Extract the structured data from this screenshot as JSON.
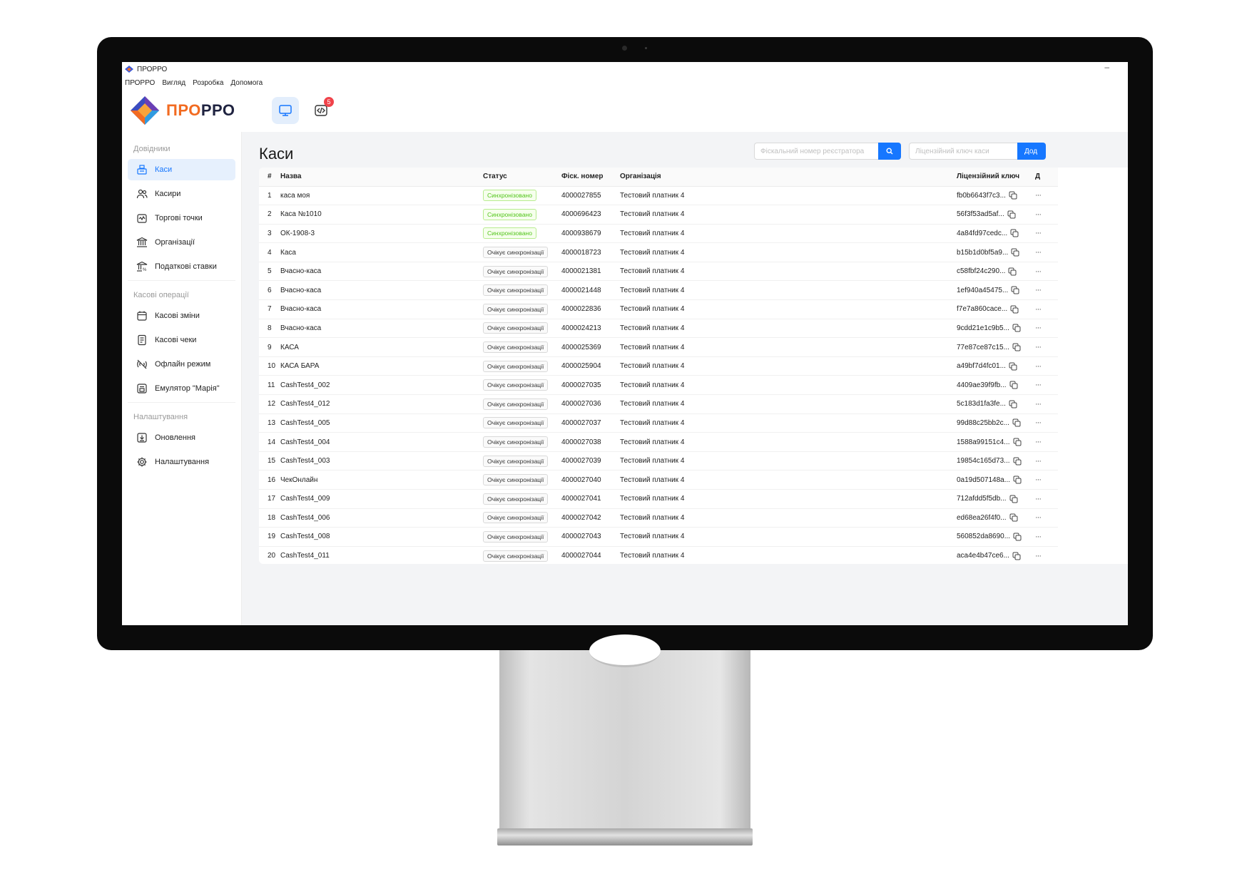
{
  "window": {
    "title": "ПРОРРО"
  },
  "menu": [
    "ПРОРРО",
    "Вигляд",
    "Розробка",
    "Допомога"
  ],
  "logo": {
    "part1": "ПРО",
    "part2": "РРО"
  },
  "topbar": {
    "dev_badge": "5"
  },
  "sidebar": {
    "groups": [
      {
        "label": "Довідники",
        "items": [
          "Каси",
          "Касири",
          "Торгові точки",
          "Організації",
          "Податкові ставки"
        ]
      },
      {
        "label": "Касові операції",
        "items": [
          "Касові зміни",
          "Касові чеки",
          "Офлайн режим",
          "Емулятор \"Марія\""
        ]
      },
      {
        "label": "Налаштування",
        "items": [
          "Оновлення",
          "Налаштування"
        ]
      }
    ],
    "active": "Каси"
  },
  "page": {
    "title": "Каси",
    "search_fiscal_placeholder": "Фіскальний номер реєстратора",
    "search_license_placeholder": "Ліцензійний ключ каси",
    "add_button": "Дод"
  },
  "table": {
    "headers": [
      "#",
      "Назва",
      "Статус",
      "Фіск. номер",
      "Організація",
      "Ліцензійний ключ",
      "Д"
    ],
    "rows": [
      [
        "1",
        "каса моя",
        "Синхронізовано",
        "4000027855",
        "Тестовий платник 4",
        "fb0b6643f7c3..."
      ],
      [
        "2",
        "Каса №1010",
        "Синхронізовано",
        "4000696423",
        "Тестовий платник 4",
        "56f3f53ad5af..."
      ],
      [
        "3",
        "ОК-1908-3",
        "Синхронізовано",
        "4000938679",
        "Тестовий платник 4",
        "4a84fd97cedc..."
      ],
      [
        "4",
        "Каса",
        "Очікує синхронізації",
        "4000018723",
        "Тестовий платник 4",
        "b15b1d0bf5a9..."
      ],
      [
        "5",
        "Вчасно-каса",
        "Очікує синхронізації",
        "4000021381",
        "Тестовий платник 4",
        "c58fbf24c290..."
      ],
      [
        "6",
        "Вчасно-каса",
        "Очікує синхронізації",
        "4000021448",
        "Тестовий платник 4",
        "1ef940a45475..."
      ],
      [
        "7",
        "Вчасно-каса",
        "Очікує синхронізації",
        "4000022836",
        "Тестовий платник 4",
        "f7e7a860cace..."
      ],
      [
        "8",
        "Вчасно-каса",
        "Очікує синхронізації",
        "4000024213",
        "Тестовий платник 4",
        "9cdd21e1c9b5..."
      ],
      [
        "9",
        "КАСА",
        "Очікує синхронізації",
        "4000025369",
        "Тестовий платник 4",
        "77e87ce87c15..."
      ],
      [
        "10",
        "КАСА БАРА",
        "Очікує синхронізації",
        "4000025904",
        "Тестовий платник 4",
        "a49bf7d4fc01..."
      ],
      [
        "11",
        "CashTest4_002",
        "Очікує синхронізації",
        "4000027035",
        "Тестовий платник 4",
        "4409ae39f9fb..."
      ],
      [
        "12",
        "CashTest4_012",
        "Очікує синхронізації",
        "4000027036",
        "Тестовий платник 4",
        "5c183d1fa3fe..."
      ],
      [
        "13",
        "CashTest4_005",
        "Очікує синхронізації",
        "4000027037",
        "Тестовий платник 4",
        "99d88c25bb2c..."
      ],
      [
        "14",
        "CashTest4_004",
        "Очікує синхронізації",
        "4000027038",
        "Тестовий платник 4",
        "1588a99151c4..."
      ],
      [
        "15",
        "CashTest4_003",
        "Очікує синхронізації",
        "4000027039",
        "Тестовий платник 4",
        "19854c165d73..."
      ],
      [
        "16",
        "ЧекОнлайн",
        "Очікує синхронізації",
        "4000027040",
        "Тестовий платник 4",
        "0a19d507148a..."
      ],
      [
        "17",
        "CashTest4_009",
        "Очікує синхронізації",
        "4000027041",
        "Тестовий платник 4",
        "712afdd5f5db..."
      ],
      [
        "18",
        "CashTest4_006",
        "Очікує синхронізації",
        "4000027042",
        "Тестовий платник 4",
        "ed68ea26f4f0..."
      ],
      [
        "19",
        "CashTest4_008",
        "Очікує синхронізації",
        "4000027043",
        "Тестовий платник 4",
        "560852da8690..."
      ],
      [
        "20",
        "CashTest4_011",
        "Очікує синхронізації",
        "4000027044",
        "Тестовий платник 4",
        "aca4e4b47ce6..."
      ]
    ],
    "synced_status": "Синхронізовано",
    "row_menu": "···"
  },
  "colors": {
    "accent": "#1677ff",
    "synced": "#52c41a",
    "badge": "#f0434a",
    "logo_orange": "#f26b21",
    "logo_navy": "#1f2340"
  },
  "icons": {
    "sidebar": [
      "cash-register-icon",
      "users-icon",
      "stall-icon",
      "bank-icon",
      "tax-icon",
      "calendar-icon",
      "receipt-icon",
      "offline-icon",
      "printer-icon",
      "download-icon",
      "gear-icon"
    ],
    "topbar": [
      "monitor-icon",
      "code-icon"
    ],
    "row": [
      "copy-icon",
      "more-icon"
    ]
  }
}
